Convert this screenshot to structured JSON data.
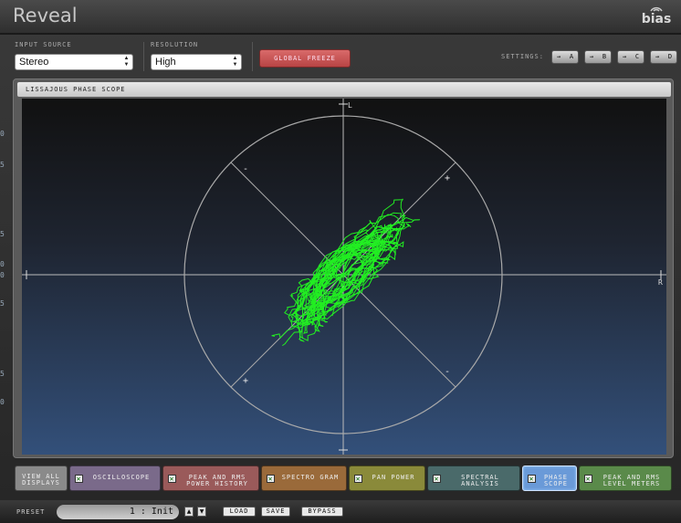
{
  "app": {
    "title": "Reveal",
    "brand": "bias"
  },
  "controls": {
    "input_source_label": "INPUT SOURCE",
    "input_source_value": "Stereo",
    "resolution_label": "RESOLUTION",
    "resolution_value": "High",
    "global_freeze_label": "GLOBAL FREEZE",
    "settings_label": "SETTINGS:",
    "settings_buttons": [
      {
        "arrow": "→",
        "letter": "A"
      },
      {
        "arrow": "→",
        "letter": "B"
      },
      {
        "arrow": "→",
        "letter": "C"
      },
      {
        "arrow": "→",
        "letter": "D"
      }
    ]
  },
  "panel": {
    "title": "LISSAJOUS PHASE SCOPE",
    "axis_labels": {
      "top": "L",
      "right": "R"
    },
    "quadrant_signs": {
      "upper_left": "-",
      "upper_right": "+",
      "lower_left": "+",
      "lower_right": "-"
    },
    "trace_color": "#22ee22"
  },
  "left_edge_glyphs": [
    "0",
    "5",
    "5",
    "0",
    "0",
    "5",
    "5",
    "0"
  ],
  "tabs": [
    {
      "label": "VIEW ALL DISPLAYS",
      "checked": false,
      "active": false,
      "color": "#8a8a8a"
    },
    {
      "label": "OSCILLOSCOPE",
      "checked": true,
      "active": false,
      "color": "#7a6a8a"
    },
    {
      "label": "PEAK AND RMS POWER HISTORY",
      "checked": true,
      "active": false,
      "color": "#9a5a5a"
    },
    {
      "label": "SPECTRO GRAM",
      "checked": true,
      "active": false,
      "color": "#9a6a3a"
    },
    {
      "label": "PAN POWER",
      "checked": true,
      "active": false,
      "color": "#8a8a3a"
    },
    {
      "label": "SPECTRAL ANALYSIS",
      "checked": true,
      "active": false,
      "color": "#4a6a6a"
    },
    {
      "label": "PHASE SCOPE",
      "checked": true,
      "active": true,
      "color": "#6a9ad8"
    },
    {
      "label": "PEAK AND RMS LEVEL METERS",
      "checked": true,
      "active": false,
      "color": "#5a8a4a"
    }
  ],
  "bottom": {
    "preset_label": "PRESET",
    "preset_value": "1 : Init",
    "up_arrow": "▲",
    "down_arrow": "▼",
    "load_label": "LOAD",
    "save_label": "SAVE",
    "bypass_label": "BYPASS"
  }
}
